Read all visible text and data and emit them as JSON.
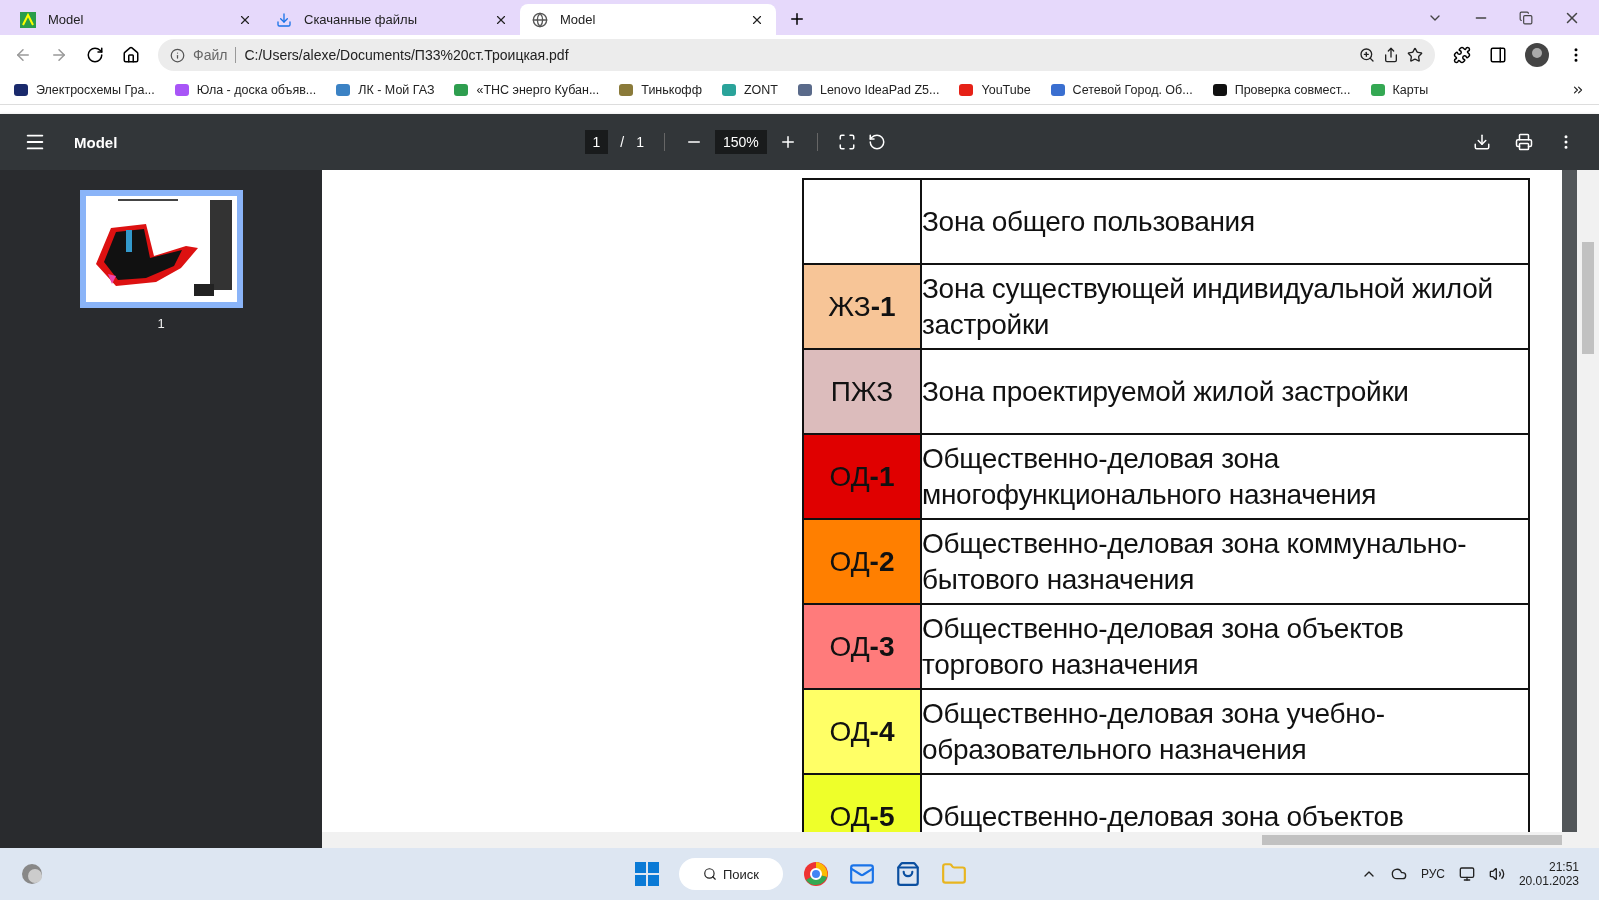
{
  "browser": {
    "tabs": [
      {
        "title": "Model",
        "selected": false,
        "kind": "app"
      },
      {
        "title": "Скачанные файлы",
        "selected": false,
        "kind": "download"
      },
      {
        "title": "Model",
        "selected": true,
        "kind": "globe"
      }
    ],
    "address": {
      "scheme_label": "Файл",
      "url": "C:/Users/alexe/Documents/П33%20ст.Троицкая.pdf"
    },
    "bookmarks": [
      {
        "label": "Электросхемы Гра...",
        "color": "#1a2a6c"
      },
      {
        "label": "Юла - доска объяв...",
        "color": "#a855f7"
      },
      {
        "label": "ЛК - Мой ГАЗ",
        "color": "#3b82c4"
      },
      {
        "label": "«ТНС энерго Кубан...",
        "color": "#2e9e4f"
      },
      {
        "label": "Тинькофф",
        "color": "#8a7a3a"
      },
      {
        "label": "ZONT",
        "color": "#2aa39a"
      },
      {
        "label": "Lenovo IdeaPad Z5...",
        "color": "#5a6a8a"
      },
      {
        "label": "YouTube",
        "color": "#e62117"
      },
      {
        "label": "Сетевой Город. Об...",
        "color": "#3a6fd0"
      },
      {
        "label": "Проверка совмест...",
        "color": "#111111"
      },
      {
        "label": "Карты",
        "color": "#34a853"
      }
    ]
  },
  "pdf_toolbar": {
    "title": "Model",
    "page": "1",
    "page_separator": "/",
    "page_count": "1",
    "zoom": "150%"
  },
  "sidebar": {
    "thumbnails": [
      {
        "label": "1",
        "selected": true
      }
    ]
  },
  "legend_rows": [
    {
      "description": "Зона общего пользования"
    },
    {
      "code": "ЖЗ**-1**",
      "color": "#f7c597",
      "description": "Зона существующей индивидуальной жилой застройки"
    },
    {
      "code": "ПЖЗ",
      "color": "#dcbcbc",
      "description": "Зона проектируемой жилой застройки"
    },
    {
      "code": "ОД**-1**",
      "color": "#e00000",
      "description": "Общественно-деловая зона многофункционального назначения"
    },
    {
      "code": "ОД**-2**",
      "color": "#ff7f00",
      "description": "Общественно-деловая зона коммунально-бытового назначения"
    },
    {
      "code": "ОД**-3**",
      "color": "#ff7b7b",
      "description": "Общественно-деловая зона объектов торгового назначения"
    },
    {
      "code": "ОД**-4**",
      "color": "#ffff66",
      "description": "Общественно-деловая зона учебно-образовательного назначения"
    },
    {
      "code": "ОД**-5**",
      "color": "#eeff2a",
      "description": "Общественно-деловая зона объектов"
    }
  ],
  "taskbar": {
    "search": "Поиск",
    "language": "РУС",
    "time": "21:51",
    "date": "20.01.2023"
  }
}
